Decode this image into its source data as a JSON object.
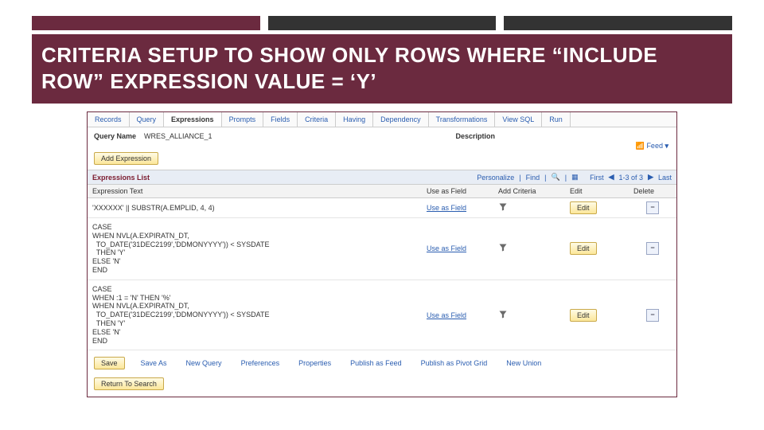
{
  "slide_title": "CRITERIA SETUP TO SHOW ONLY ROWS WHERE “INCLUDE ROW” EXPRESSION VALUE = ‘Y’",
  "tabs": [
    "Records",
    "Query",
    "Expressions",
    "Prompts",
    "Fields",
    "Criteria",
    "Having",
    "Dependency",
    "Transformations",
    "View SQL",
    "Run"
  ],
  "active_tab": "Expressions",
  "query": {
    "name_label": "Query Name",
    "name_value": "WRES_ALLIANCE_1",
    "description_label": "Description",
    "feed_label": "Feed",
    "add_expression": "Add Expression"
  },
  "list": {
    "title": "Expressions List",
    "controls": {
      "personalize": "Personalize",
      "find": "Find",
      "first": "First",
      "range": "1-3 of 3",
      "last": "Last"
    },
    "columns": [
      "Expression Text",
      "Use as Field",
      "Add Criteria",
      "Edit",
      "Delete"
    ],
    "use_label": "Use as Field",
    "edit_label": "Edit",
    "rows": [
      {
        "expr": "'XXXXXX' || SUBSTR(A.EMPLID, 4, 4)"
      },
      {
        "expr": "CASE\nWHEN NVL(A.EXPIRATN_DT,\n  TO_DATE('31DEC2199','DDMONYYYY')) < SYSDATE\n  THEN 'Y'\nELSE 'N'\nEND"
      },
      {
        "expr": "CASE\nWHEN :1 = 'N' THEN '%'\nWHEN NVL(A.EXPIRATN_DT,\n  TO_DATE('31DEC2199','DDMONYYYY')) < SYSDATE\n  THEN 'Y'\nELSE 'N'\nEND"
      }
    ]
  },
  "footer": {
    "save": "Save",
    "links": [
      "Save As",
      "New Query",
      "Preferences",
      "Properties",
      "Publish as Feed",
      "Publish as Pivot Grid",
      "New Union"
    ],
    "return": "Return To Search"
  }
}
